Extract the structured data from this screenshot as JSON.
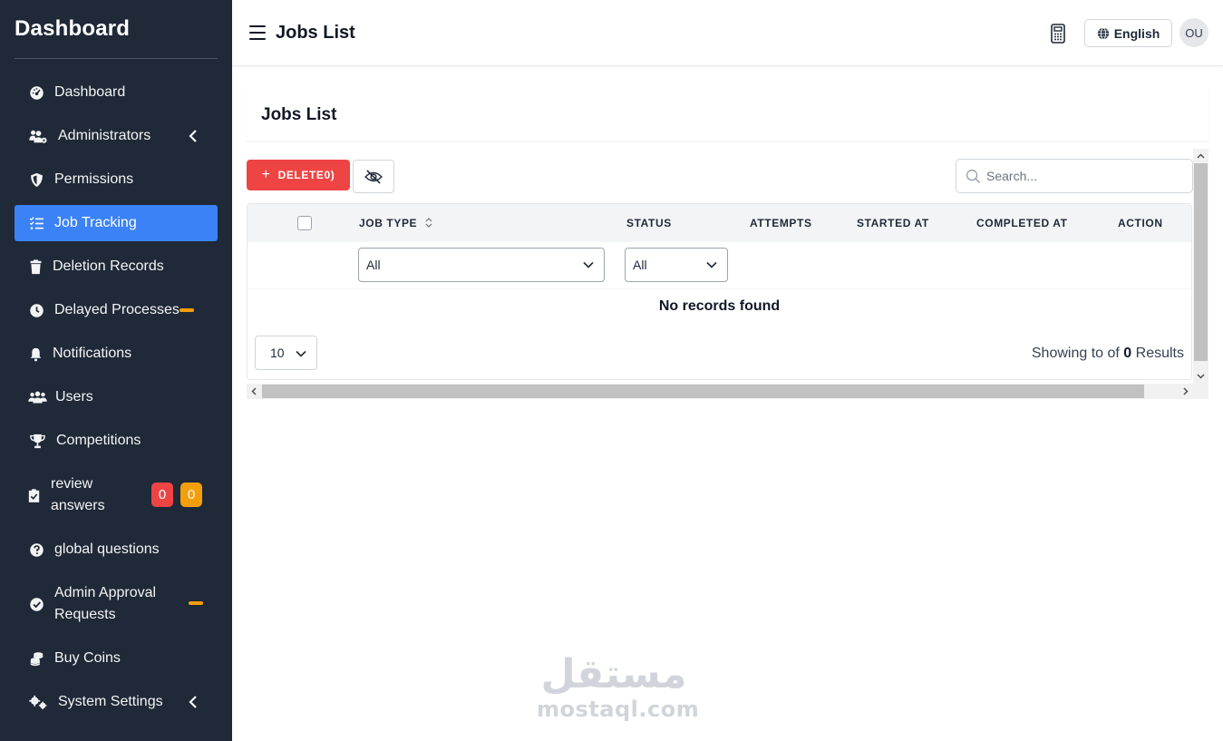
{
  "sidebar": {
    "brand": "Dashboard",
    "items": [
      {
        "label": "Dashboard",
        "icon": "gauge-icon"
      },
      {
        "label": "Administrators",
        "icon": "users-gear-icon",
        "has_chevron": true
      },
      {
        "label": "Permissions",
        "icon": "shield-icon"
      },
      {
        "label": "Job Tracking",
        "icon": "list-check-icon",
        "active": true
      },
      {
        "label": "Deletion Records",
        "icon": "trash-icon"
      },
      {
        "label": "Delayed Processes",
        "icon": "clock-icon"
      },
      {
        "label": "Notifications",
        "icon": "bell-icon"
      },
      {
        "label": "Users",
        "icon": "users-icon"
      },
      {
        "label": "Competitions",
        "icon": "trophy-icon"
      },
      {
        "label": "review answers",
        "icon": "clipboard-check-icon",
        "badges": [
          "0",
          "0"
        ]
      },
      {
        "label": "global questions",
        "icon": "question-circle-icon"
      },
      {
        "label": "Admin Approval Requests",
        "icon": "check-circle-icon"
      },
      {
        "label": "Buy Coins",
        "icon": "coins-icon"
      },
      {
        "label": "System Settings",
        "icon": "gears-icon",
        "has_chevron": true
      }
    ]
  },
  "header": {
    "title": "Jobs List",
    "language": "English",
    "avatar_initials": "OU"
  },
  "content": {
    "card_title": "Jobs List",
    "delete_button": "DELETE0)",
    "search_placeholder": "Search...",
    "columns": {
      "job_type": "JOB TYPE",
      "status": "STATUS",
      "attempts": "ATTEMPTS",
      "started_at": "STARTED AT",
      "completed_at": "COMPLETED AT",
      "action": "ACTION"
    },
    "filters": {
      "job_type": "All",
      "status": "All"
    },
    "empty_message": "No records found",
    "per_page": "10",
    "showing_prefix": "Showing to of",
    "showing_count": "0",
    "showing_suffix": "Results"
  },
  "watermark": {
    "arabic": "مستقل",
    "latin": "mostaql.com"
  },
  "colors": {
    "sidebar_bg": "#1f2937",
    "active_item": "#3b82f6",
    "danger": "#ef4444",
    "warning": "#f59e0b"
  }
}
